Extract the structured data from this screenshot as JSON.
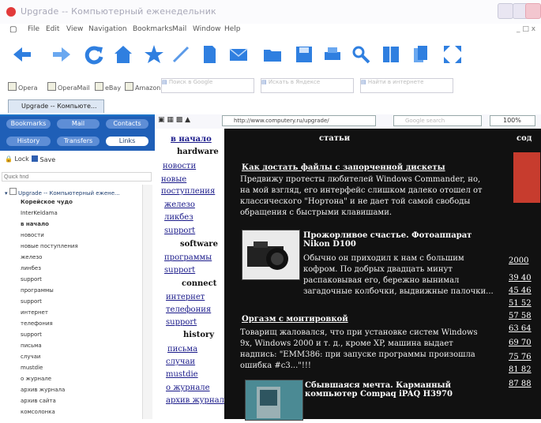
{
  "window": {
    "title": "Upgrade -- Компьютерный еженедельник"
  },
  "menu": [
    "File",
    "Edit",
    "View",
    "Navigation",
    "Bookmarks",
    "Mail",
    "Window",
    "Help"
  ],
  "toolbar_icons": [
    "back-icon",
    "forward-icon",
    "reload-icon",
    "home-icon",
    "hotlist-icon",
    "pen-icon",
    "document-icon",
    "mail-icon",
    "folder-icon",
    "save-icon",
    "print-icon",
    "find-icon",
    "panel-icon",
    "pages-icon",
    "fullscreen-icon"
  ],
  "bookmarks": {
    "items": [
      "Opera",
      "OperaMail",
      "eBay",
      "Amazon"
    ],
    "search1_placeholder": "Поиск в Google",
    "search2_placeholder": "Искать в Яндексе",
    "search3_placeholder": "Найти в интернете"
  },
  "tab": {
    "label": "Upgrade -- Компьюте..."
  },
  "panel": {
    "buttons_row1": [
      "Bookmarks",
      "Mail",
      "Contacts"
    ],
    "buttons_row2": [
      "History",
      "Transfers",
      "Links"
    ],
    "lock_label": "Lock",
    "save_label": "Save",
    "search_placeholder": "Quick find",
    "tree_root": "Upgrade -- Компьютерный ежене...",
    "tree": [
      "Корейское чудо",
      "InterKeldama",
      "в начало",
      "новости",
      "новые поступления",
      "железо",
      "линбез",
      "support",
      "программы",
      "support",
      "интернет",
      "телефония",
      "support",
      "письма",
      "случаи",
      "mustdie",
      "о журнале",
      "архив журнала",
      "архив сайта",
      "комсолонка"
    ]
  },
  "address": {
    "url": "http://www.computery.ru/upgrade/",
    "search_placeholder": "Google search",
    "zoom": "100%"
  },
  "page": {
    "nav": {
      "top": "в начало",
      "hardware": "hardware",
      "hardware_links": [
        "новости",
        "новые",
        "поступления",
        "железо",
        "ликбез",
        "support"
      ],
      "software": "software",
      "software_links": [
        "программы",
        "support"
      ],
      "connect": "connect",
      "connect_links": [
        "интернет",
        "телефония",
        "support"
      ],
      "history": "history",
      "history_links": [
        "письма",
        "случаи",
        "mustdie",
        "о журнале",
        "архив журнала"
      ]
    },
    "column_header": "статьи",
    "right_header": "сод",
    "articles": [
      {
        "title": "Как достать файлы с запорченной дискеты",
        "text": "Предвижу протесты любителей Windows Commander, но, на мой взгляд, его интерфейс слишком далеко отошел от классического \"Нортона\" и не дает той самой свободы обращения с быстрыми клавишами."
      },
      {
        "title": "Прожорливое счастье. Фотоаппарат Nikon D100",
        "text": "Обычно он приходил к нам с большим кофром. По добрых двадцать минут распаковывая его, бережно вынимал загадочные колбочки, выдвижные палочки..."
      },
      {
        "title": "Оргазм с монтировкой",
        "text": "Товарищ жаловался, что при установке систем Windows 9x, Windows 2000 и т. д., кроме XP, машина выдает надпись: \"EMM386: при запуске программы произошла ошибка #c3...\"!!!"
      },
      {
        "title": "Сбывшаяся мечта. Карманный компьютер Compaq iPAQ H3970",
        "text": ""
      }
    ],
    "right_numbers": [
      "2000",
      "39 40",
      "45 46",
      "51 52",
      "57 58",
      "63 64",
      "69 70",
      "75 76",
      "81 82",
      "87 88"
    ]
  },
  "colors": {
    "accent": "#1f5fb7",
    "page_bg": "#121212",
    "link": "#1a1a8a"
  }
}
